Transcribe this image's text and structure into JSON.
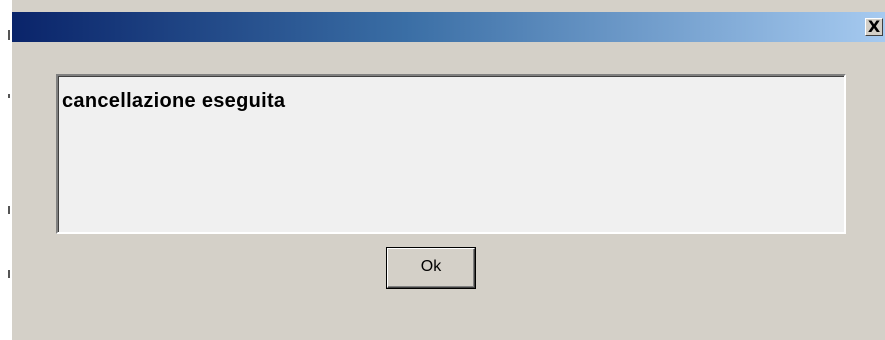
{
  "dialog": {
    "title": "",
    "close_label": "X",
    "message": "cancellazione eseguita",
    "ok_label": "Ok"
  },
  "colors": {
    "titlebar_start": "#0a246a",
    "titlebar_end": "#a6caf0",
    "dialog_background": "#d4d0c8",
    "message_background": "#f0f0f0"
  }
}
